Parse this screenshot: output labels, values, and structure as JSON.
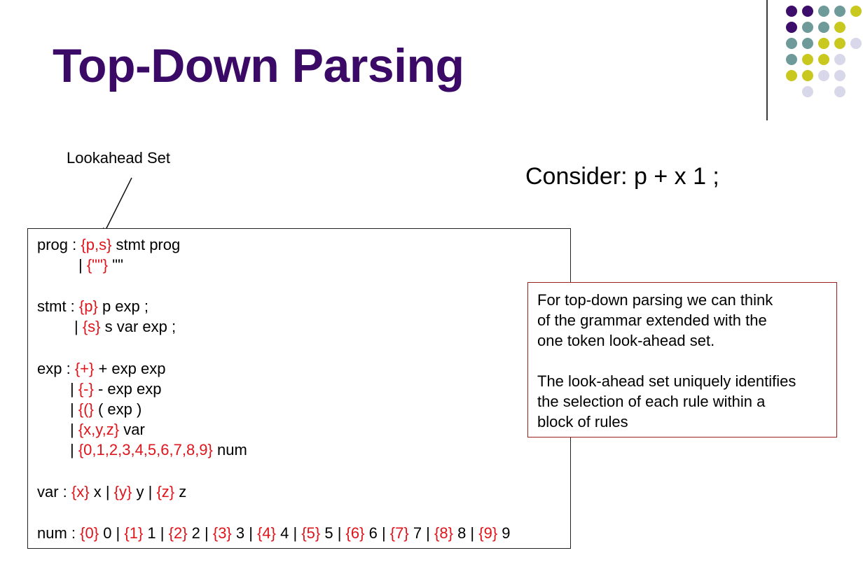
{
  "slide": {
    "title": "Top-Down Parsing",
    "colors": {
      "title": "#3a0a66",
      "lookahead": "#e0141b",
      "note_border": "#9b2020",
      "dot_purple": "#3d0d6b",
      "dot_teal": "#6e9a9a",
      "dot_olive": "#c8c81e",
      "dot_lavender": "#d8d8ea"
    }
  },
  "annotation": {
    "label": "Lookahead Set"
  },
  "consider": "Consider: p + x 1 ;",
  "grammar": [
    {
      "segments": [
        {
          "t": "prog : "
        },
        {
          "t": "{p,s}",
          "la": true
        },
        {
          "t": " stmt prog"
        }
      ]
    },
    {
      "segments": [
        {
          "t": "| "
        },
        {
          "t": "{\"\"}",
          "la": true
        },
        {
          "t": " \"\""
        }
      ]
    },
    {
      "segments": [
        {
          "t": "stmt : "
        },
        {
          "t": "{p}",
          "la": true
        },
        {
          "t": " p exp ;"
        }
      ]
    },
    {
      "segments": [
        {
          "t": "| "
        },
        {
          "t": "{s}",
          "la": true
        },
        {
          "t": " s var exp ;"
        }
      ]
    },
    {
      "segments": [
        {
          "t": "exp : "
        },
        {
          "t": "{+}",
          "la": true
        },
        {
          "t": " + exp exp"
        }
      ]
    },
    {
      "segments": [
        {
          "t": "| "
        },
        {
          "t": "{-}",
          "la": true
        },
        {
          "t": " - exp exp"
        }
      ]
    },
    {
      "segments": [
        {
          "t": "| "
        },
        {
          "t": "{(}",
          "la": true
        },
        {
          "t": " ( exp )"
        }
      ]
    },
    {
      "segments": [
        {
          "t": "| "
        },
        {
          "t": "{x,y,z}",
          "la": true
        },
        {
          "t": " var"
        }
      ]
    },
    {
      "segments": [
        {
          "t": "| "
        },
        {
          "t": "{0,1,2,3,4,5,6,7,8,9}",
          "la": true
        },
        {
          "t": " num"
        }
      ]
    },
    {
      "segments": [
        {
          "t": "var : "
        },
        {
          "t": "{x}",
          "la": true
        },
        {
          "t": " x | "
        },
        {
          "t": "{y}",
          "la": true
        },
        {
          "t": " y | "
        },
        {
          "t": "{z}",
          "la": true
        },
        {
          "t": " z"
        }
      ]
    },
    {
      "segments": [
        {
          "t": "num : "
        },
        {
          "t": "{0}",
          "la": true
        },
        {
          "t": " 0 | "
        },
        {
          "t": "{1}",
          "la": true
        },
        {
          "t": " 1 | "
        },
        {
          "t": "{2}",
          "la": true
        },
        {
          "t": " 2 | "
        },
        {
          "t": "{3}",
          "la": true
        },
        {
          "t": " 3 | "
        },
        {
          "t": "{4}",
          "la": true
        },
        {
          "t": " 4 | "
        },
        {
          "t": "{5}",
          "la": true
        },
        {
          "t": " 5 | "
        },
        {
          "t": "{6}",
          "la": true
        },
        {
          "t": " 6 | "
        },
        {
          "t": "{7}",
          "la": true
        },
        {
          "t": " 7 | "
        },
        {
          "t": "{8}",
          "la": true
        },
        {
          "t": " 8 | "
        },
        {
          "t": "{9}",
          "la": true
        },
        {
          "t": " 9"
        }
      ]
    }
  ],
  "note": {
    "paragraphs": [
      "For top-down parsing we can think\nof the grammar extended with the\none token look-ahead set.",
      "The look-ahead set uniquely identifies\nthe selection of each rule within a\nblock of rules"
    ]
  },
  "decor": {
    "dot_rows": [
      [
        "purple",
        "purple",
        "teal",
        "teal",
        "olive"
      ],
      [
        "purple",
        "teal",
        "teal",
        "olive"
      ],
      [
        "teal",
        "teal",
        "olive",
        "olive",
        "lavender"
      ],
      [
        "teal",
        "olive",
        "olive",
        "lavender"
      ],
      [
        "olive",
        "olive",
        "lavender",
        "lavender"
      ],
      [
        "lavender",
        "lavender"
      ]
    ]
  }
}
